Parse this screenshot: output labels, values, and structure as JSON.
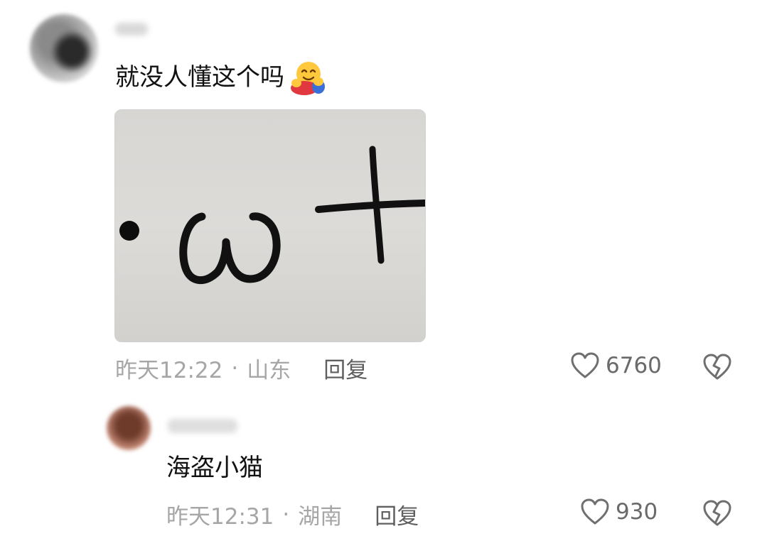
{
  "comment": {
    "text": "就没人懂这个吗",
    "emoji": "hugging-face-emoji",
    "image": {
      "description_icon": "dot-omega-plus-drawing"
    },
    "time": "昨天12:22",
    "separator": "·",
    "location": "山东",
    "reply_label": "回复",
    "likes": "6760"
  },
  "reply": {
    "text": "海盗小猫",
    "time": "昨天12:31",
    "separator": "·",
    "location": "湖南",
    "reply_label": "回复",
    "likes": "930"
  },
  "colors": {
    "meta_text": "#a6a6a6",
    "reply_label": "#5f5f5f",
    "like_text": "#6a6a6a",
    "icon_stroke": "#6f6f6f"
  }
}
